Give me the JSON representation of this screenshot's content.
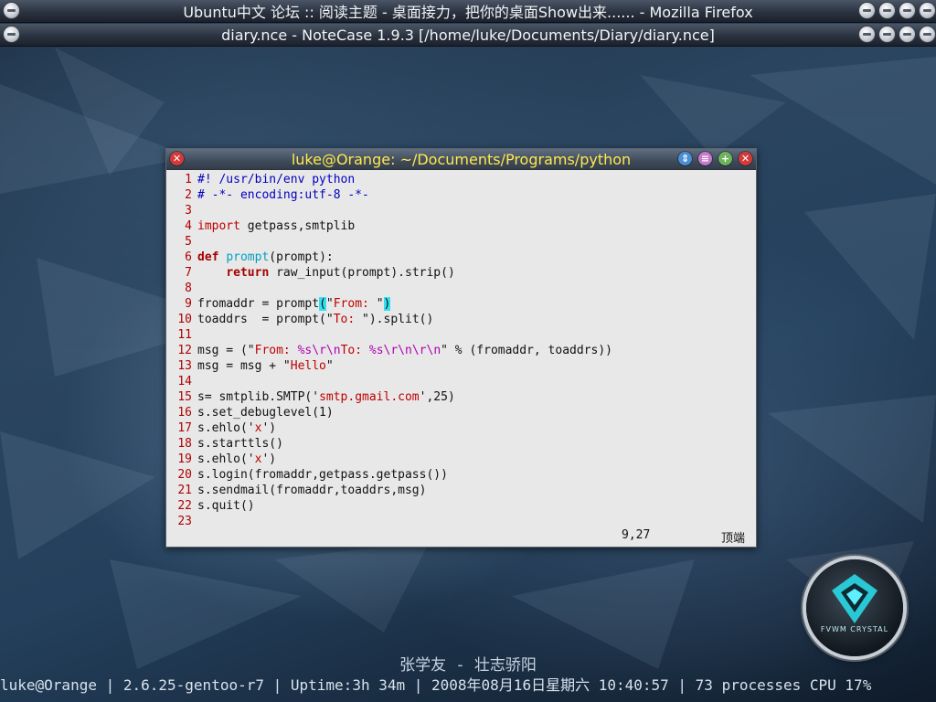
{
  "firefox_window": {
    "title": "Ubuntu中文 论坛 :: 阅读主题 - 桌面接力，把你的桌面Show出来...... - Mozilla Firefox"
  },
  "notecase_window": {
    "title": "diary.nce - NoteCase 1.9.3 [/home/luke/Documents/Diary/diary.nce]"
  },
  "terminal": {
    "title": "luke@Orange: ~/Documents/Programs/python",
    "buttons": [
      "scroll-icon",
      "shade-icon",
      "maximize-icon",
      "close-icon"
    ],
    "lines": [
      {
        "n": "1",
        "segs": [
          {
            "t": "#! /usr/bin/env python",
            "c": "cm"
          }
        ]
      },
      {
        "n": "2",
        "segs": [
          {
            "t": "# -*- encoding:utf-8 -*-",
            "c": "cm"
          }
        ]
      },
      {
        "n": "3",
        "segs": []
      },
      {
        "n": "4",
        "segs": [
          {
            "t": "import",
            "c": "str"
          },
          {
            "t": " getpass,smtplib",
            "c": ""
          }
        ]
      },
      {
        "n": "5",
        "segs": []
      },
      {
        "n": "6",
        "segs": [
          {
            "t": "def",
            "c": "kw"
          },
          {
            "t": " ",
            "c": ""
          },
          {
            "t": "prompt",
            "c": "fn"
          },
          {
            "t": "(prompt):",
            "c": ""
          }
        ]
      },
      {
        "n": "7",
        "segs": [
          {
            "t": "    ",
            "c": ""
          },
          {
            "t": "return",
            "c": "kw"
          },
          {
            "t": " raw_input(prompt).strip()",
            "c": ""
          }
        ]
      },
      {
        "n": "8",
        "segs": []
      },
      {
        "n": "9",
        "segs": [
          {
            "t": "fromaddr = prompt",
            "c": ""
          },
          {
            "t": "(",
            "c": "mt"
          },
          {
            "t": "\"",
            "c": ""
          },
          {
            "t": "From: ",
            "c": "str"
          },
          {
            "t": "\"",
            "c": ""
          },
          {
            "t": ")",
            "c": "mt"
          }
        ]
      },
      {
        "n": "10",
        "segs": [
          {
            "t": "toaddrs  = prompt(\"",
            "c": ""
          },
          {
            "t": "To: ",
            "c": "str"
          },
          {
            "t": "\").split()",
            "c": ""
          }
        ]
      },
      {
        "n": "11",
        "segs": []
      },
      {
        "n": "12",
        "segs": [
          {
            "t": "msg = (\"",
            "c": ""
          },
          {
            "t": "From: ",
            "c": "str"
          },
          {
            "t": "%s\\r\\n",
            "c": "esc"
          },
          {
            "t": "To: ",
            "c": "str"
          },
          {
            "t": "%s\\r\\n\\r\\n",
            "c": "esc"
          },
          {
            "t": "\" % (fromaddr, toaddrs))",
            "c": ""
          }
        ]
      },
      {
        "n": "13",
        "segs": [
          {
            "t": "msg = msg + \"",
            "c": ""
          },
          {
            "t": "Hello",
            "c": "str"
          },
          {
            "t": "\"",
            "c": ""
          }
        ]
      },
      {
        "n": "14",
        "segs": []
      },
      {
        "n": "15",
        "segs": [
          {
            "t": "s= smtplib.SMTP('",
            "c": ""
          },
          {
            "t": "smtp.gmail.com",
            "c": "str"
          },
          {
            "t": "',25)",
            "c": ""
          }
        ]
      },
      {
        "n": "16",
        "segs": [
          {
            "t": "s.set_debuglevel(1)",
            "c": ""
          }
        ]
      },
      {
        "n": "17",
        "segs": [
          {
            "t": "s.ehlo('",
            "c": ""
          },
          {
            "t": "x",
            "c": "str"
          },
          {
            "t": "')",
            "c": ""
          }
        ]
      },
      {
        "n": "18",
        "segs": [
          {
            "t": "s.starttls()",
            "c": ""
          }
        ]
      },
      {
        "n": "19",
        "segs": [
          {
            "t": "s.ehlo('",
            "c": ""
          },
          {
            "t": "x",
            "c": "str"
          },
          {
            "t": "')",
            "c": ""
          }
        ]
      },
      {
        "n": "20",
        "segs": [
          {
            "t": "s.login(fromaddr,getpass.getpass())",
            "c": ""
          }
        ]
      },
      {
        "n": "21",
        "segs": [
          {
            "t": "s.sendmail(fromaddr,toaddrs,msg)",
            "c": ""
          }
        ]
      },
      {
        "n": "22",
        "segs": [
          {
            "t": "s.quit()",
            "c": ""
          }
        ]
      },
      {
        "n": "23",
        "segs": []
      }
    ],
    "cursor_position": "9,27",
    "scroll_position": "顶端"
  },
  "logo": {
    "text": "FVWM CRYSTAL"
  },
  "desktop": {
    "song": "张学友 - 壮志骄阳",
    "status_line": "luke@Orange | 2.6.25-gentoo-r7 | Uptime:3h 34m | 2008年08月16日星期六 10:40:57 | 73 processes CPU 17%"
  },
  "colors": {
    "terminal_title_text": "#ffe94d",
    "comment": "#0000c0",
    "keyword": "#a40000",
    "string": "#c00000",
    "function": "#00a0c0",
    "escape": "#b000b0",
    "match_highlight": "#33e0f0"
  }
}
